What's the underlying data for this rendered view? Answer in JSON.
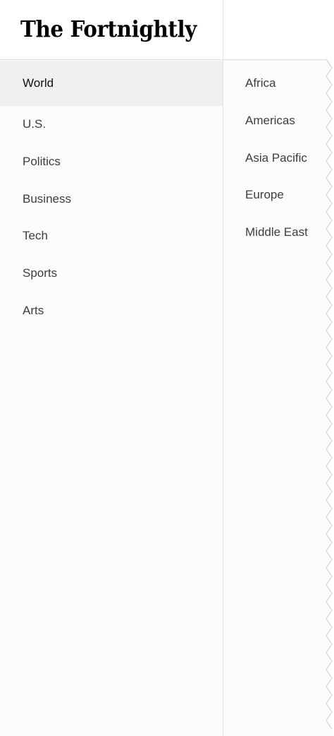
{
  "header": {
    "logo_text": "The Fortnightly"
  },
  "sections": {
    "selected": "World",
    "items": [
      {
        "label": "World"
      },
      {
        "label": "U.S."
      },
      {
        "label": "Politics"
      },
      {
        "label": "Business"
      },
      {
        "label": "Tech"
      },
      {
        "label": "Sports"
      },
      {
        "label": "Arts"
      }
    ]
  },
  "subsections": {
    "items": [
      {
        "label": "Africa"
      },
      {
        "label": "Americas"
      },
      {
        "label": "Asia Pacific"
      },
      {
        "label": "Europe"
      },
      {
        "label": "Middle East"
      }
    ]
  },
  "colors": {
    "selected_background": "#efefef",
    "text": "#3d3d3d",
    "panel_background": "#fcfcfc",
    "divider": "#e3e3e3"
  }
}
